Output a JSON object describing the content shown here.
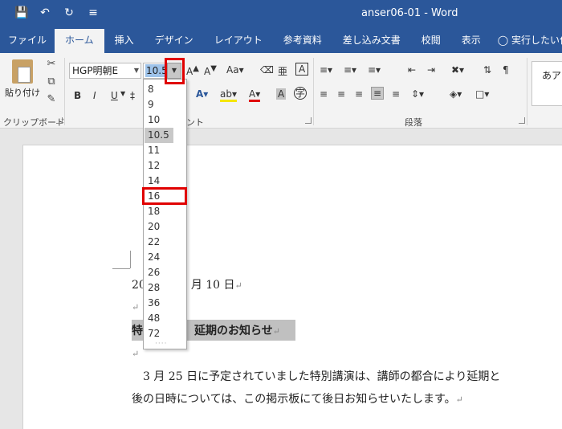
{
  "window": {
    "title": "anser06-01 - Word"
  },
  "tabs": [
    "ファイル",
    "ホーム",
    "挿入",
    "デザイン",
    "レイアウト",
    "参考資料",
    "差し込み文書",
    "校閲",
    "表示"
  ],
  "tell_me": "実行したい作業",
  "clipboard": {
    "paste_label": "貼り付け",
    "group_label": "クリップボード"
  },
  "font": {
    "name": "HGP明朝E",
    "size": "10.5",
    "group_label_partial": "ント"
  },
  "paragraph": {
    "group_label": "段落"
  },
  "styles": {
    "preview": "あア"
  },
  "font_size_options": [
    "8",
    "9",
    "10",
    "10.5",
    "11",
    "12",
    "14",
    "16",
    "18",
    "20",
    "22",
    "24",
    "26",
    "28",
    "36",
    "48",
    "72"
  ],
  "selected_size": "10.5",
  "document": {
    "date_line": {
      "prefix": "20",
      "suffix": "月 10 日"
    },
    "heading": {
      "prefix": "特",
      "suffix": "延期のお知らせ"
    },
    "body_line1": "　3 月 25 日に予定されていました特別講演は、講師の都合により延期と",
    "body_line2": "後の日時については、この掲示板にて後日お知らせいたします。"
  },
  "colors": {
    "ribbon_blue": "#2b579a",
    "highlight_red": "#e00000"
  }
}
